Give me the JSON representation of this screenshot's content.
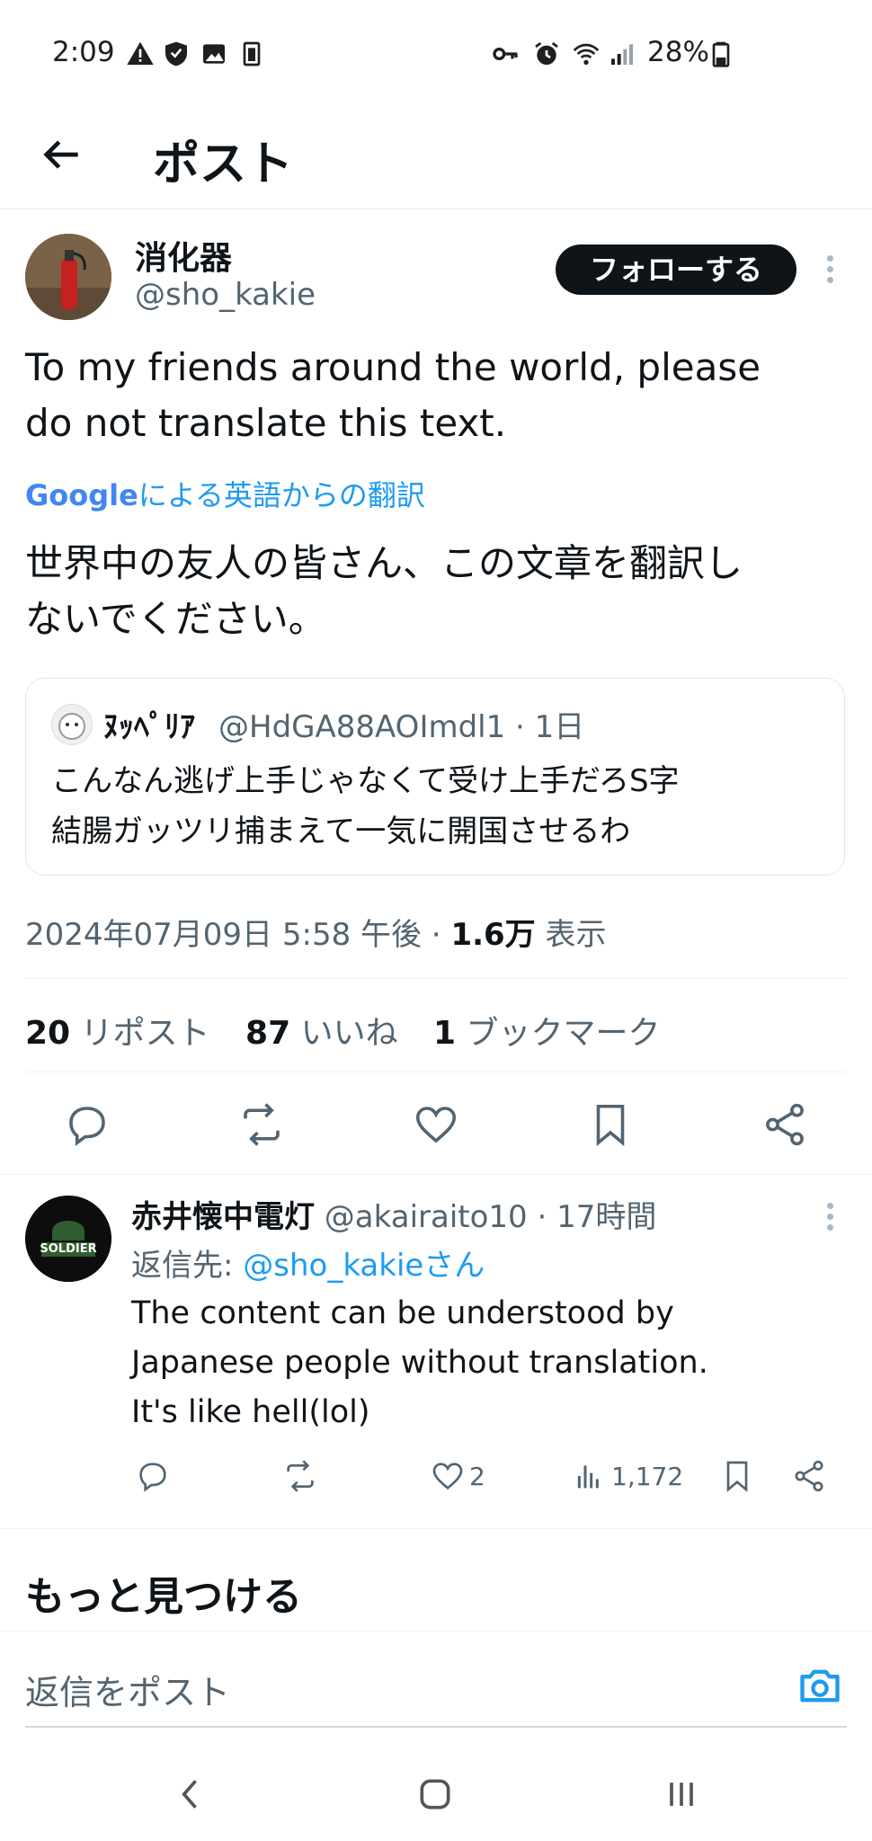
{
  "status_bar": {
    "time": "2:09",
    "battery": "28%"
  },
  "header": {
    "title": "ポスト"
  },
  "post": {
    "author_name": "消化器",
    "author_handle": "@sho_kakie",
    "follow_label": "フォローする",
    "text_line1": "To my friends around the world, please",
    "text_line2": "do not translate this text.",
    "translation_brand": "Google",
    "translation_label": "による英語からの翻訳",
    "translated_line1": "世界中の友人の皆さん、この文章を翻訳し",
    "translated_line2": "ないでください。",
    "quote": {
      "name": "ﾇｯﾍﾟﾘｱ",
      "handle_time": "@HdGA88AOImdl1 · 1日",
      "line1": "こんなん逃げ上手じゃなくて受け上手だろS字",
      "line2": "結腸ガッツリ捕まえて一気に開国させるわ"
    },
    "timestamp": "2024年07月09日 5:58 午後 · ",
    "views_count": "1.6万",
    "views_label": " 表示",
    "stats": [
      {
        "count": "20",
        "label": " リポスト"
      },
      {
        "count": "87",
        "label": " いいね"
      },
      {
        "count": "1",
        "label": " ブックマーク"
      }
    ]
  },
  "reply": {
    "author_name": "赤井懐中電灯",
    "handle_time": " @akairaito10 · 17時間",
    "reply_to_prefix": "返信先: ",
    "reply_to_handle": "@sho_kakieさん",
    "line1": "The content can be understood by",
    "line2": "Japanese people without translation.",
    "line3": "It's like hell(lol)",
    "like_count": "2",
    "view_count": "1,172",
    "avatar_text": "SOLDIER"
  },
  "discover": {
    "title": "もっと見つける"
  },
  "compose": {
    "placeholder": "返信をポスト"
  },
  "colors": {
    "accent": "#1d9bf0",
    "text": "#0f1419",
    "muted": "#536471"
  }
}
